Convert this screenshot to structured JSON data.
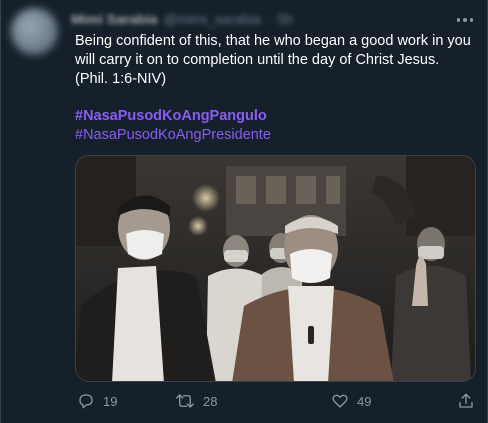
{
  "tweet": {
    "author_name": "Mimi Sarabia",
    "author_handle": "@mimi_sarabia",
    "separator": "·",
    "time": "5h",
    "text": "Being confident of this, that he who began a good work in you will carry it on to completion until the day of Christ Jesus. (Phil. 1:6-NIV)",
    "hashtags": [
      "#NasaPusodKoAngPangulo",
      "#NasaPusodKoAngPresidente"
    ],
    "counts": {
      "replies": "19",
      "retweets": "28",
      "likes": "49"
    },
    "icons": {
      "more": "more-dots-icon",
      "reply": "reply-icon",
      "retweet": "retweet-icon",
      "like": "heart-icon",
      "share": "share-icon"
    }
  },
  "colors": {
    "background": "#15202b",
    "text": "#ffffff",
    "secondary": "#8899a6",
    "hashtag": "#8a5cf6",
    "border": "#38444d"
  }
}
